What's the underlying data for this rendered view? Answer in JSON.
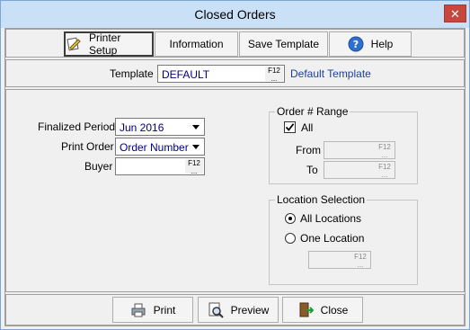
{
  "window": {
    "title": "Closed Orders",
    "close_glyph": "✕"
  },
  "toolbar": {
    "printer_setup": "Printer Setup",
    "information": "Information",
    "save_template": "Save Template",
    "help": "Help"
  },
  "template": {
    "label": "Template",
    "value": "DEFAULT",
    "description": "Default Template",
    "lookup_key": "F12"
  },
  "form": {
    "finalized_period": {
      "label": "Finalized Period",
      "value": "Jun 2016"
    },
    "print_order": {
      "label": "Print Order",
      "value": "Order Number"
    },
    "buyer": {
      "label": "Buyer",
      "value": "",
      "lookup_key": "F12"
    }
  },
  "order_range": {
    "title": "Order # Range",
    "all_label": "All",
    "all_checked": true,
    "from_label": "From",
    "to_label": "To",
    "lookup_key": "F12"
  },
  "location": {
    "title": "Location Selection",
    "all_label": "All Locations",
    "one_label": "One Location",
    "selected": "all",
    "lookup_key": "F12"
  },
  "bottom": {
    "print": "Print",
    "preview": "Preview",
    "close": "Close"
  }
}
